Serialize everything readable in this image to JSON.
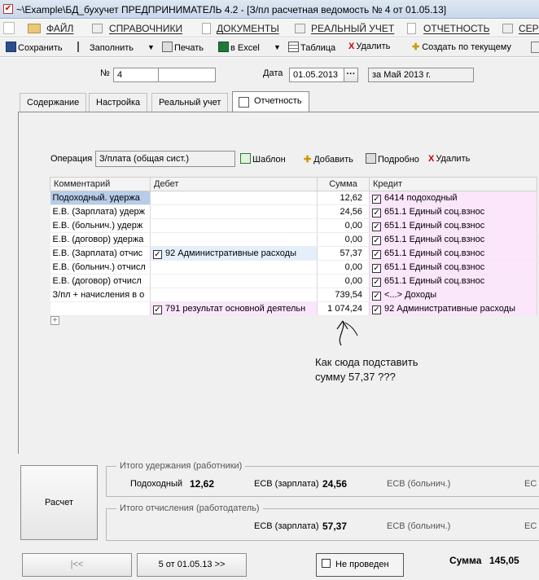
{
  "title": "~\\Example\\БД_бухучет  ПРЕДПРИНИМАТЕЛЬ 4.2 - [З/пл расчетная ведомость № 4 от 01.05.13]",
  "menu": [
    "ФАЙЛ",
    "СПРАВОЧНИКИ",
    "ДОКУМЕНТЫ",
    "РЕАЛЬНЫЙ УЧЕТ",
    "ОТЧЕТНОСТЬ",
    "СЕРВ"
  ],
  "toolbar": {
    "save": "Сохранить",
    "fill": "Заполнить",
    "print": "Печать",
    "excel": "в Excel",
    "table": "Таблица",
    "delete": "Удалить",
    "create": "Создать по текущему"
  },
  "header": {
    "num_label": "№",
    "num_value": "4",
    "date_label": "Дата",
    "date_value": "01.05.2013",
    "date_btn": "···",
    "period_value": "за Май 2013 г."
  },
  "tabs": [
    "Содержание",
    "Настройка",
    "Реальный учет",
    "Отчетность"
  ],
  "operation": {
    "label": "Операция",
    "value": "З/плата (общая сист.)",
    "template": "Шаблон",
    "add": "Добавить",
    "details": "Подробно",
    "delete": "Удалить"
  },
  "table": {
    "columns": [
      "Комментарий",
      "Дебет",
      "Сумма",
      "Кредит"
    ],
    "rows": [
      {
        "comment": "Подоходный. удержа",
        "debet": "",
        "sum": "12,62",
        "credit": "6414 подоходный"
      },
      {
        "comment": "Е.В. (Зарплата) удерж",
        "debet": "",
        "sum": "24,56",
        "credit": "651.1 Единый соц.взнос"
      },
      {
        "comment": "Е.В. (больнич.) удерж",
        "debet": "",
        "sum": "0,00",
        "credit": "651.1 Единый соц.взнос"
      },
      {
        "comment": "Е.В. (договор) удержа",
        "debet": "",
        "sum": "0,00",
        "credit": "651.1 Единый соц.взнос"
      },
      {
        "comment": "Е.В. (Зарплата) отчис",
        "debet": "92 Административные расходы",
        "sum": "57,37",
        "credit": "651.1 Единый соц.взнос"
      },
      {
        "comment": "Е.В. (больнич.) отчисл",
        "debet": "",
        "sum": "0,00",
        "credit": "651.1 Единый соц.взнос"
      },
      {
        "comment": "Е.В. (договор) отчисл",
        "debet": "",
        "sum": "0,00",
        "credit": "651.1 Единый соц.взнос"
      },
      {
        "comment": "З/пл + начисления в о",
        "debet": "",
        "sum": "739,54",
        "credit": "<...> Доходы"
      },
      {
        "comment": "",
        "debet": "791  результат основной деятельн",
        "sum": "1 074,24",
        "credit": "92 Административные расходы"
      }
    ],
    "add_row": "+"
  },
  "annotation": {
    "line1": "Как сюда подставить",
    "line2": "сумму 57,37 ???"
  },
  "calc_button": "Расчет",
  "withholding": {
    "title": "Итого удержания (работники)",
    "income_label": "Подоходный",
    "income_value": "12,62",
    "esv_salary_label": "ЕСВ (зарплата)",
    "esv_salary_value": "24,56",
    "esv_sick_label": "ЕСВ (больнич.)",
    "esv_more_label": "ЕС"
  },
  "accrual": {
    "title": "Итого отчисления (работодатель)",
    "esv_salary_label": "ЕСВ (зарплата)",
    "esv_salary_value": "57,37",
    "esv_sick_label": "ЕСВ (больнич.)",
    "esv_more_label": "ЕС"
  },
  "footer": {
    "first_btn": "|<<",
    "nav_btn": "5 от 01.05.13 >>",
    "status_label": "Не проведен",
    "sum_label": "Сумма",
    "sum_value": "145,05"
  }
}
